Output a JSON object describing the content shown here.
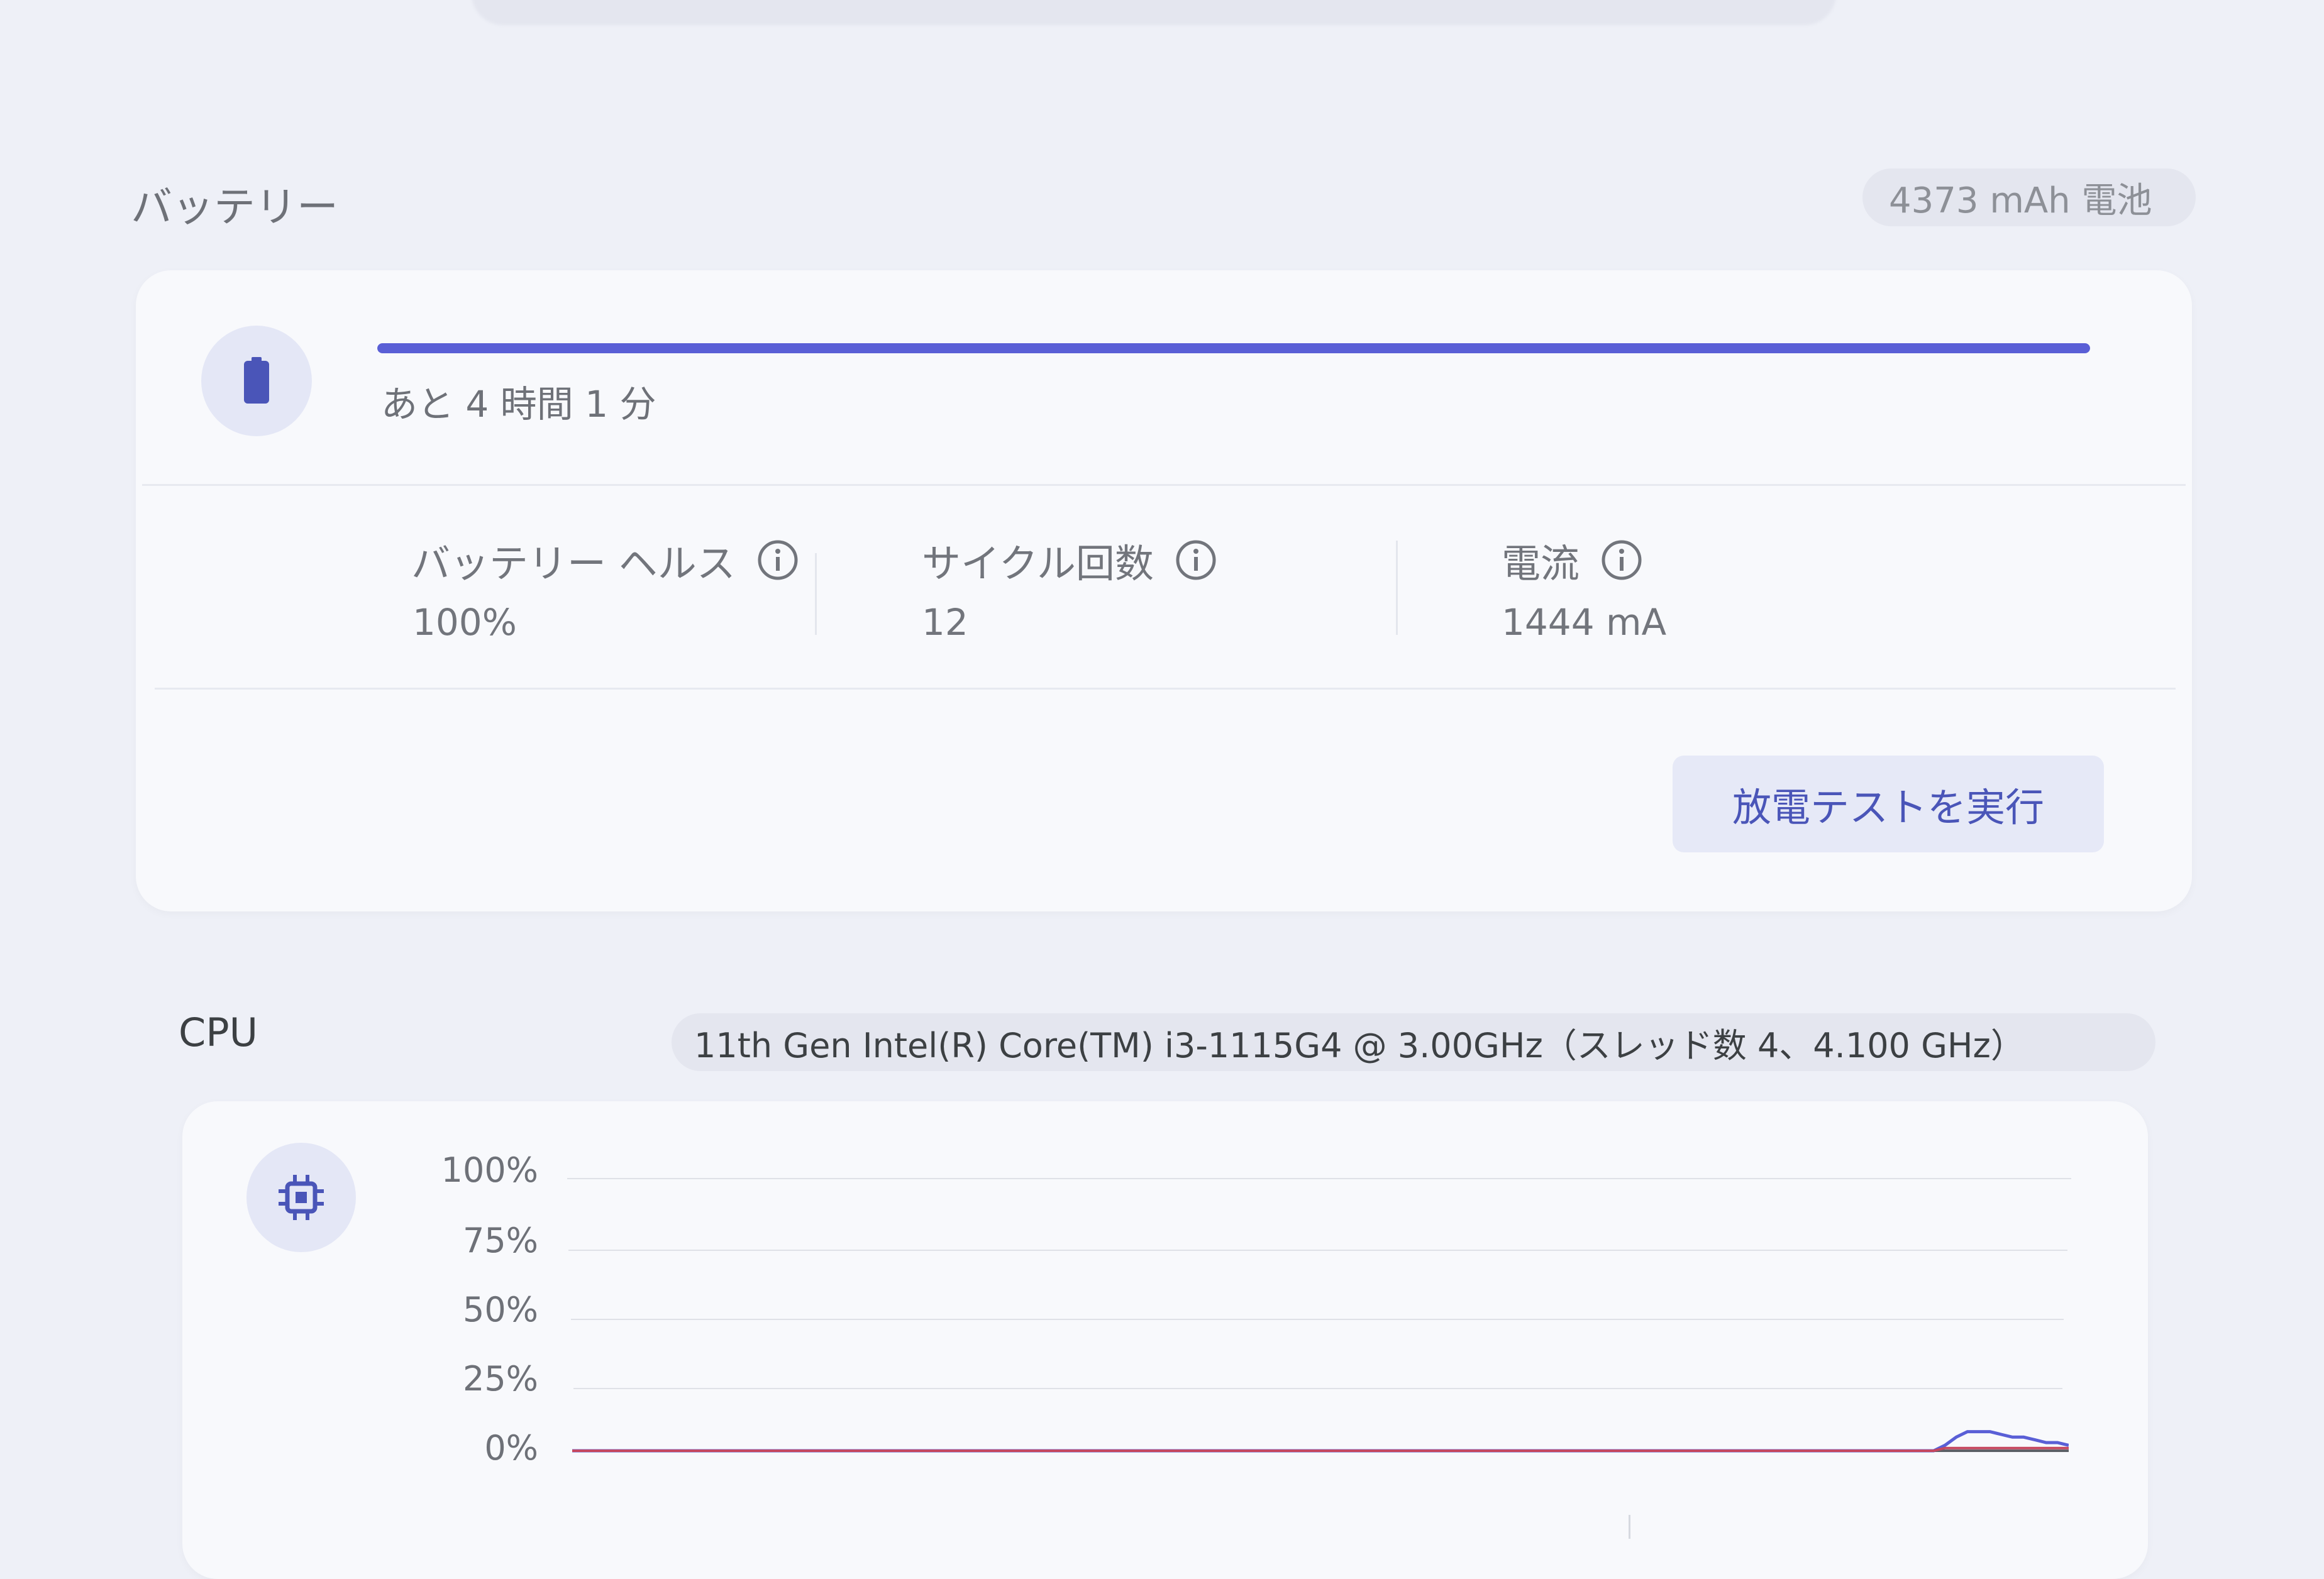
{
  "battery": {
    "title": "バッテリー",
    "capacity_chip": "4373 mAh 電池",
    "charge_level": 1.0,
    "time_remaining": "あと 4 時間 1 分",
    "stats": [
      {
        "label": "バッテリー ヘルス",
        "value": "100%"
      },
      {
        "label": "サイクル回数",
        "value": "12"
      },
      {
        "label": "電流",
        "value": "1444 mA"
      }
    ],
    "discharge_button": "放電テストを実行"
  },
  "cpu": {
    "title": "CPU",
    "model_chip": "11th Gen Intel(R) Core(TM) i3-1115G4 @ 3.00GHz（スレッド数 4、4.100 GHz）"
  },
  "chart_data": {
    "type": "line",
    "y_ticks": [
      "100%",
      "75%",
      "50%",
      "25%",
      "0%"
    ],
    "ylim": [
      0,
      100
    ],
    "grid": true,
    "series": [
      {
        "color": "#5a5fd6",
        "values": [
          0,
          0,
          0,
          0,
          0,
          0,
          0,
          0,
          0,
          0,
          0,
          0,
          0,
          0,
          0,
          0,
          0,
          0,
          0,
          0,
          0,
          0,
          0,
          0,
          0,
          0,
          0,
          0,
          0,
          0,
          0,
          0,
          0,
          0,
          0,
          0,
          0,
          0,
          0,
          0,
          0,
          0,
          0,
          0,
          0,
          0,
          0,
          0,
          0,
          0,
          0,
          0,
          0,
          0,
          0,
          0,
          0,
          0,
          0,
          0,
          0,
          0,
          0,
          0,
          0,
          0,
          0,
          0,
          0,
          0,
          0,
          0,
          0,
          0,
          0,
          0,
          0,
          0,
          0,
          0,
          0,
          0,
          0,
          0,
          0,
          0,
          0,
          0,
          0,
          0,
          0,
          0,
          0,
          0,
          0,
          0,
          0,
          0,
          0,
          0,
          0,
          0,
          0,
          0,
          0,
          0,
          0,
          0,
          0,
          0,
          0,
          0,
          0,
          0,
          0,
          0,
          0,
          0,
          0,
          0,
          0,
          0,
          2,
          5,
          7,
          7,
          7,
          6,
          5,
          5,
          4,
          3,
          3,
          2
        ]
      },
      {
        "color": "#c5475f",
        "values": [
          0,
          0,
          0,
          0,
          0,
          0,
          0,
          0,
          0,
          0,
          0,
          0,
          0,
          0,
          0,
          0,
          0,
          0,
          0,
          0,
          0,
          0,
          0,
          0,
          0,
          0,
          0,
          0,
          0,
          0,
          0,
          0,
          0,
          0,
          0,
          0,
          0,
          0,
          0,
          0,
          0,
          0,
          0,
          0,
          0,
          0,
          0,
          0,
          0,
          0,
          0,
          0,
          0,
          0,
          0,
          0,
          0,
          0,
          0,
          0,
          0,
          0,
          0,
          0,
          0,
          0,
          0,
          0,
          0,
          0,
          0,
          0,
          0,
          0,
          0,
          0,
          0,
          0,
          0,
          0,
          0,
          0,
          0,
          0,
          0,
          0,
          0,
          0,
          0,
          0,
          0,
          0,
          0,
          0,
          0,
          0,
          0,
          0,
          0,
          0,
          0,
          0,
          0,
          0,
          0,
          0,
          0,
          0,
          0,
          0,
          0,
          0,
          0,
          0,
          0,
          0,
          0,
          0,
          0,
          0,
          0,
          0,
          1,
          1,
          1,
          1,
          1,
          1,
          1,
          1,
          1,
          1,
          1,
          1
        ]
      }
    ]
  },
  "icons": {
    "battery": "battery-icon",
    "cpu": "cpu-chip-icon",
    "info": "info-icon"
  },
  "colors": {
    "accent": "#5a5fd6",
    "card": "#f8f9fc",
    "background": "#eef0f7"
  }
}
